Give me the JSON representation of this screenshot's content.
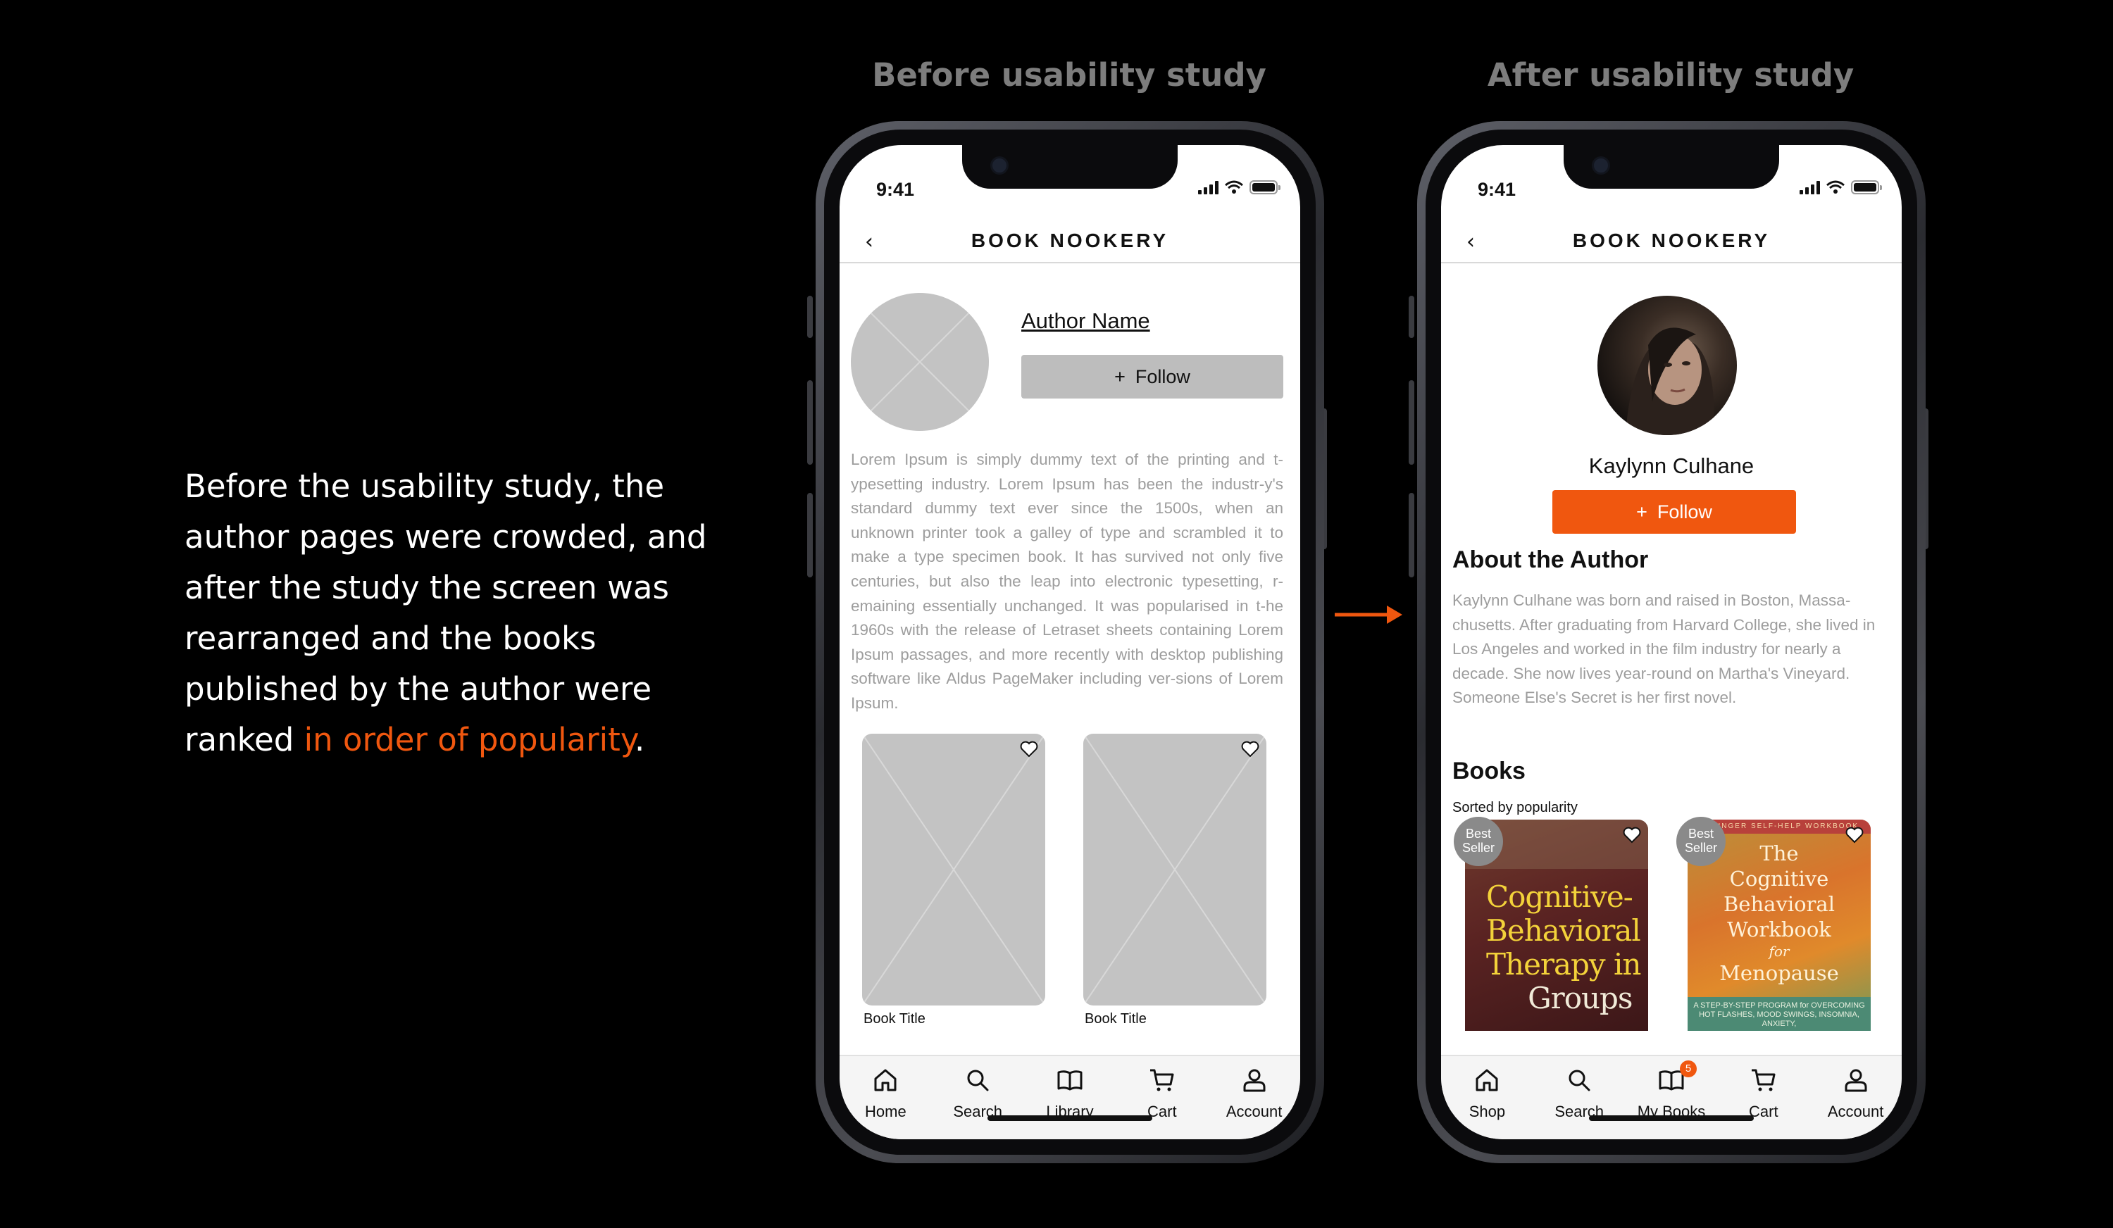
{
  "story": {
    "text_before": "Before the usability study, the author pages were crowded, and after the study the screen was rearranged and the books published by the author were ranked ",
    "highlight": "in order of popularity",
    "text_after": "."
  },
  "labels": {
    "before": "Before usability study",
    "after": "After usability study"
  },
  "colors": {
    "accent": "#f0570f",
    "placeholder": "#c3c3c3",
    "muted_text": "#9d9d9d"
  },
  "before": {
    "status_time": "9:41",
    "app_title": "BOOK NOOKERY",
    "back_icon": "chevron-left-icon",
    "author_name": "Author Name",
    "follow_label": "Follow",
    "bio": "Lorem Ipsum is simply dummy text of the printing and t-ypesetting industry. Lorem Ipsum has been the industr-y's standard dummy text ever since the 1500s, when an unknown printer took a galley of type and scrambled it to make a type specimen book. It has survived not only five centuries, but also the leap into electronic typesetting, r-emaining essentially unchanged. It was popularised in t-he 1960s with the release of Letraset sheets containing Lorem Ipsum passages, and more recently with desktop publishing software like Aldus PageMaker including ver-sions of Lorem Ipsum.",
    "books": [
      {
        "title": "Book Title"
      },
      {
        "title": "Book Title"
      }
    ],
    "nav": [
      {
        "label": "Home",
        "icon": "home-icon"
      },
      {
        "label": "Search",
        "icon": "search-icon"
      },
      {
        "label": "Library",
        "icon": "book-icon"
      },
      {
        "label": "Cart",
        "icon": "cart-icon"
      },
      {
        "label": "Account",
        "icon": "user-icon"
      }
    ]
  },
  "after": {
    "status_time": "9:41",
    "app_title": "BOOK NOOKERY",
    "back_icon": "chevron-left-icon",
    "author_name": "Kaylynn Culhane",
    "follow_label": "Follow",
    "about_title": "About the Author",
    "about_text": "Kaylynn Culhane was born and raised in Boston, Massa-chusetts. After graduating from Harvard College, she lived in Los Angeles and worked in the film industry for nearly a decade. She now lives year-round on Martha's Vineyard. Someone Else's Secret is her first novel.",
    "books_title": "Books",
    "books_subtitle": "Sorted by popularity",
    "books": [
      {
        "badge": [
          "Best",
          "Seller"
        ],
        "cover_lines": [
          "Cognitive-",
          "Behavioral",
          "Therapy in",
          "Groups"
        ]
      },
      {
        "badge": [
          "Best",
          "Seller"
        ],
        "cover_top": "SPRINGER SELF-HELP WORKBOOK",
        "cover_lines": [
          "The",
          "Cognitive",
          "Behavioral",
          "Workbook",
          "for",
          "Menopause"
        ],
        "cover_bottom": "A STEP-BY-STEP PROGRAM for OVERCOMING HOT FLASHES, MOOD SWINGS, INSOMNIA, ANXIETY,"
      }
    ],
    "nav": [
      {
        "label": "Shop",
        "icon": "home-icon"
      },
      {
        "label": "Search",
        "icon": "search-icon"
      },
      {
        "label": "My Books",
        "icon": "book-icon",
        "badge": "5"
      },
      {
        "label": "Cart",
        "icon": "cart-icon"
      },
      {
        "label": "Account",
        "icon": "user-icon"
      }
    ]
  }
}
